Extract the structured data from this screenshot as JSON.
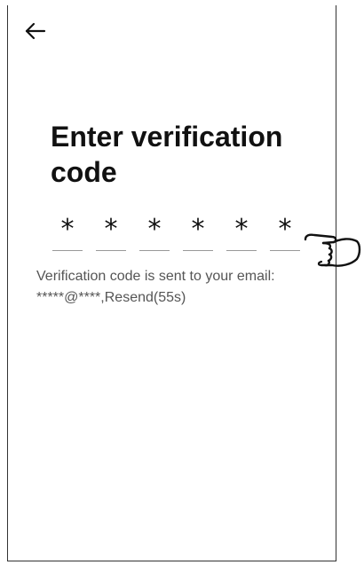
{
  "header": {
    "back_icon": "arrow-left-icon"
  },
  "title": "Enter verification code",
  "code": {
    "digits": [
      "*",
      "*",
      "*",
      "*",
      "*",
      "*"
    ]
  },
  "info": {
    "sent_text": "Verification code is sent to your email:",
    "masked_email": "*****@****",
    "separator": ",",
    "resend_label": "Resend(55s)"
  },
  "pointer": {
    "icon": "pointing-hand-icon"
  }
}
